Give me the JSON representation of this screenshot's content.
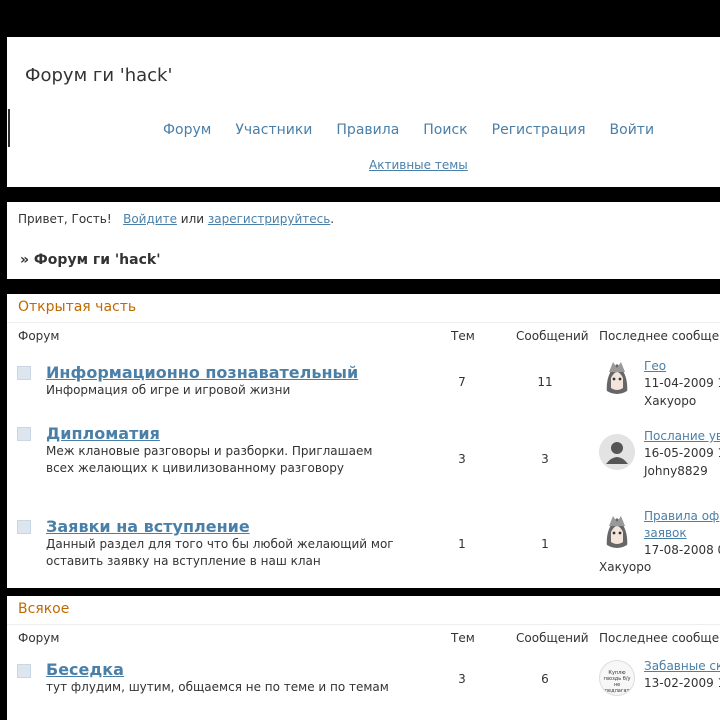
{
  "header": {
    "title": "Форум ги 'hack'",
    "nav": [
      "Форум",
      "Участники",
      "Правила",
      "Поиск",
      "Регистрация",
      "Войти"
    ],
    "active_topics": "Активные темы"
  },
  "welcome": {
    "greeting": "Привет, Гость!",
    "login": "Войдите",
    "or": "или",
    "register": "зарегистрируйтесь",
    "period": ".",
    "breadcrumb": "» Форум ги 'hack'"
  },
  "columns": {
    "forum": "Форум",
    "topics": "Тем",
    "posts": "Сообщений",
    "last": "Последнее сообщение"
  },
  "categories": [
    {
      "title": "Открытая часть",
      "forums": [
        {
          "name": "Информационно познавательный",
          "desc": "Информация об игре и игровой жизни",
          "topics": "7",
          "posts": "11",
          "last_title": "Гео",
          "last_date": "11-04-2009 1",
          "last_user": "Хакуоро",
          "avatar": "anime-girl-avatar"
        },
        {
          "name": "Дипломатия",
          "desc": "Меж клановые разговоры и разборки. Приглашаем всех желающих к цивилизованному разговору",
          "topics": "3",
          "posts": "3",
          "last_title": "Послание ув",
          "last_date": "16-05-2009 1",
          "last_user": "Johny8829",
          "avatar": "default-user-avatar"
        },
        {
          "name": "Заявки на вступление",
          "desc": "Данный раздел для того что бы любой желающий мог оставить заявку на вступление в наш клан",
          "topics": "1",
          "posts": "1",
          "last_title": "Правила оф",
          "last_title2": "заявок",
          "last_date": "17-08-2008 0",
          "last_user": "Хакуоро",
          "avatar": "anime-girl-avatar"
        }
      ]
    },
    {
      "title": "Всякое",
      "forums": [
        {
          "name": "Беседка",
          "desc": "тут флудим, шутим, общаемся не по теме и по темам",
          "topics": "3",
          "posts": "6",
          "last_title": "Забавные ск",
          "last_date": "13-02-2009 1",
          "avatar_text": "Куплю гвоздь б/у не предлагать",
          "avatar": "text-avatar"
        }
      ]
    }
  ]
}
